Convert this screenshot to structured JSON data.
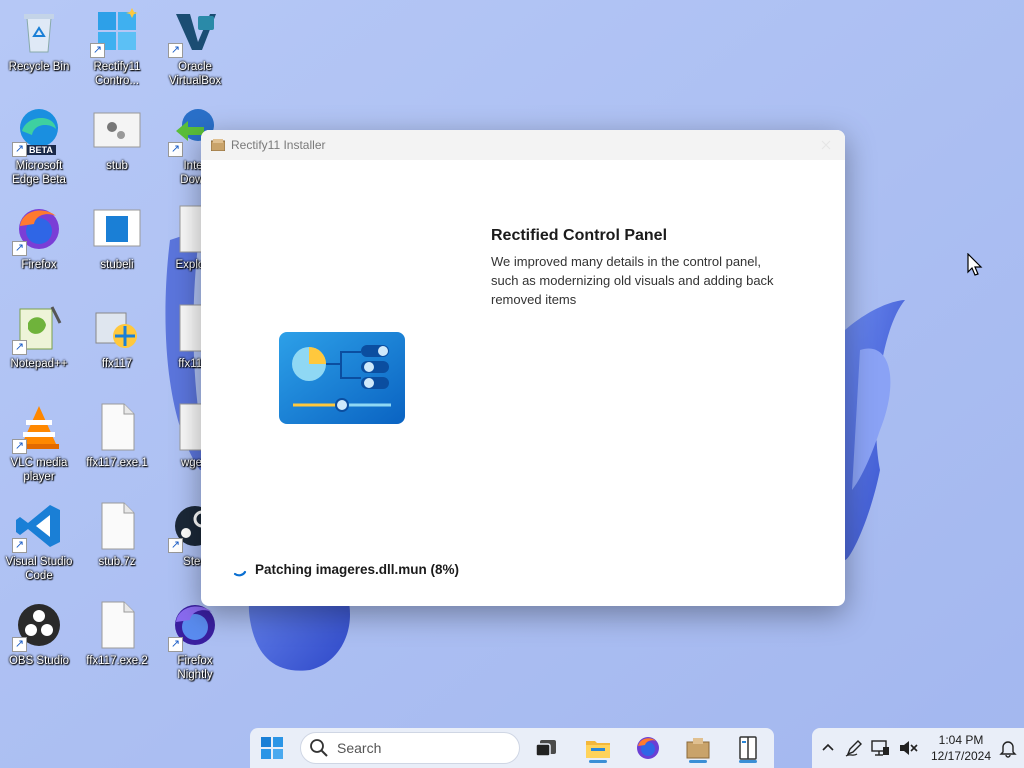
{
  "desktop": {
    "icons": [
      {
        "label": "Recycle Bin",
        "icon": "recycle-bin-icon",
        "shortcut": false
      },
      {
        "label": "Rectify11\nContro...",
        "icon": "control-panel-icon",
        "shortcut": true
      },
      {
        "label": "Oracle\nVirtualBox",
        "icon": "virtualbox-icon",
        "shortcut": true
      },
      {
        "label": "Microsoft\nEdge Beta",
        "icon": "edge-beta-icon",
        "shortcut": true,
        "badge": "BETA"
      },
      {
        "label": "stub",
        "icon": "stub-app-icon",
        "shortcut": false
      },
      {
        "label": "Inter\nDown",
        "icon": "internet-download-icon",
        "shortcut": true
      },
      {
        "label": "Firefox",
        "icon": "firefox-icon",
        "shortcut": true
      },
      {
        "label": "stubeli",
        "icon": "window-app-icon",
        "shortcut": false
      },
      {
        "label": "Explore",
        "icon": "file-icon",
        "shortcut": false
      },
      {
        "label": "Notepad++",
        "icon": "notepadpp-icon",
        "shortcut": true
      },
      {
        "label": "ffx117",
        "icon": "installer-icon",
        "shortcut": false
      },
      {
        "label": "ffx117.",
        "icon": "file-icon",
        "shortcut": false
      },
      {
        "label": "VLC media\nplayer",
        "icon": "vlc-icon",
        "shortcut": true
      },
      {
        "label": "ffx117.exe.1",
        "icon": "file-icon",
        "shortcut": false
      },
      {
        "label": "wget-",
        "icon": "file-icon",
        "shortcut": false
      },
      {
        "label": "Visual Studio\nCode",
        "icon": "vscode-icon",
        "shortcut": true
      },
      {
        "label": "stub.7z",
        "icon": "file-icon",
        "shortcut": false
      },
      {
        "label": "Stea",
        "icon": "steam-icon",
        "shortcut": true
      },
      {
        "label": "OBS Studio",
        "icon": "obs-icon",
        "shortcut": true
      },
      {
        "label": "ffx117.exe.2",
        "icon": "file-icon",
        "shortcut": false
      },
      {
        "label": "Firefox\nNightly",
        "icon": "firefox-nightly-icon",
        "shortcut": true
      }
    ]
  },
  "installer": {
    "title": "Rectify11 Installer",
    "feature_title": "Rectified Control Panel",
    "feature_description": "We improved many details in the control panel, such as modernizing old visuals and adding back removed items",
    "status": "Patching imageres.dll.mun (8%)",
    "progress_percent": 8
  },
  "taskbar": {
    "start_icon": "windows-start-icon",
    "search_placeholder": "Search",
    "pinned": [
      {
        "name": "task-view-icon",
        "running": false
      },
      {
        "name": "file-explorer-icon",
        "running": true
      },
      {
        "name": "firefox-taskbar-icon",
        "running": false
      },
      {
        "name": "installer-taskbar-icon",
        "running": true
      },
      {
        "name": "book-app-icon",
        "running": true
      }
    ]
  },
  "tray": {
    "time": "1:04 PM",
    "date": "12/17/2024"
  },
  "colors": {
    "wallpaper": "#a9bdf2",
    "bloom": "#4a64d6",
    "accent": "#0078d4"
  }
}
